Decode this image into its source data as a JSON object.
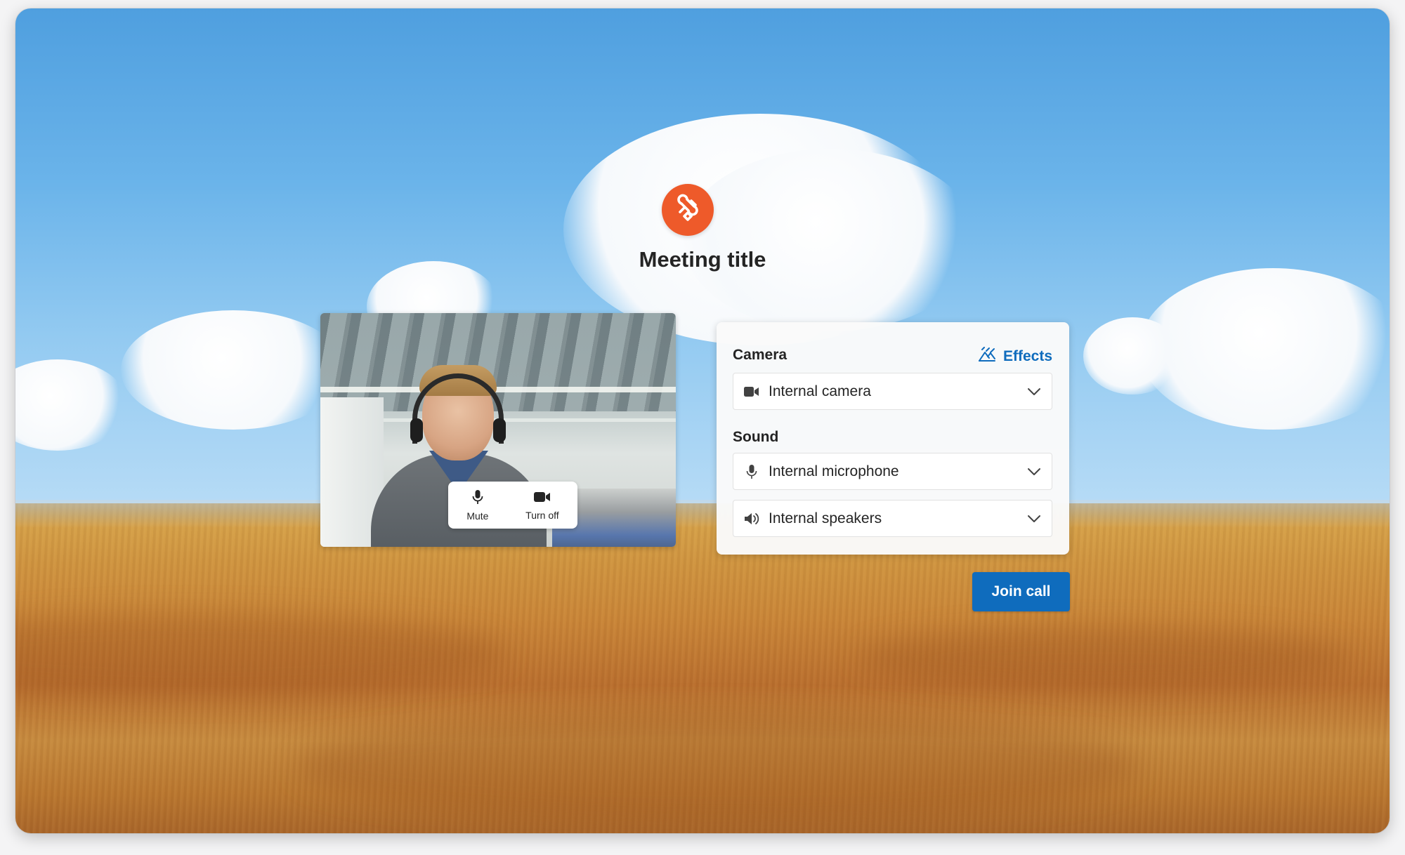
{
  "meeting": {
    "title": "Meeting title"
  },
  "preview": {
    "mute_label": "Mute",
    "camera_toggle_label": "Turn off"
  },
  "settings": {
    "camera_label": "Camera",
    "effects_label": "Effects",
    "camera_device": "Internal camera",
    "sound_label": "Sound",
    "microphone_device": "Internal microphone",
    "speaker_device": "Internal speakers"
  },
  "actions": {
    "join_label": "Join call"
  },
  "icons": {
    "logo": "app-logo-icon",
    "mic": "microphone-icon",
    "video": "video-camera-icon",
    "effects": "effects-icon",
    "speaker": "speaker-icon",
    "chevron": "chevron-down-icon"
  },
  "colors": {
    "accent": "#0f6cbd",
    "logo": "#ee5a2a"
  }
}
